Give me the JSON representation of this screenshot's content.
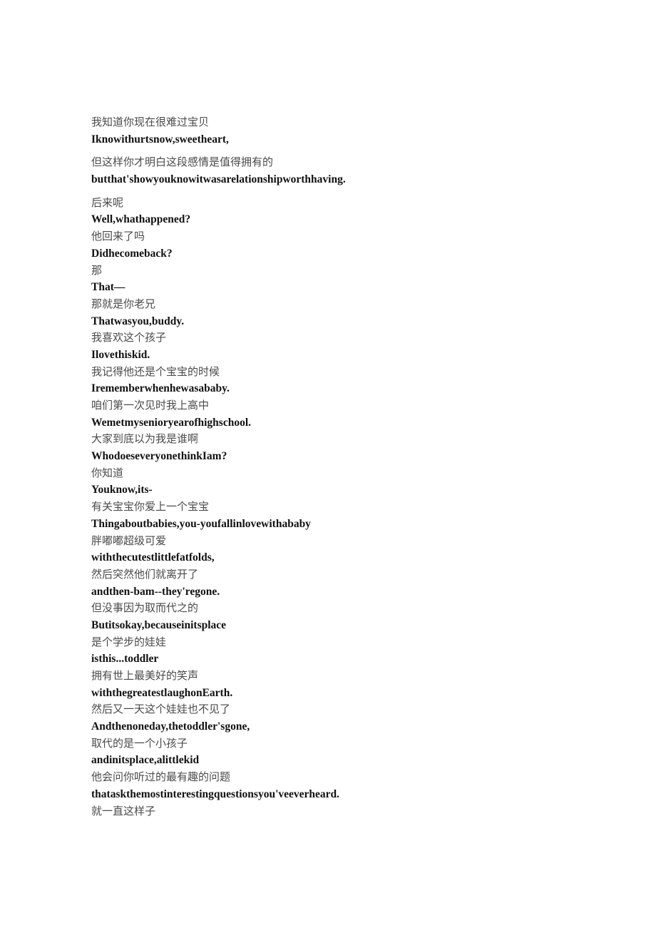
{
  "document": {
    "page_background": "#ffffff",
    "text_color_chinese": "#4a4a4a",
    "text_color_english": "#111111",
    "lines": [
      {
        "lang": "zh",
        "text": "我知道你现在很难过宝贝"
      },
      {
        "lang": "en",
        "text": "Iknowithurtsnow,sweetheart,"
      },
      {
        "lang": "zh",
        "text": "但这样你才明白这段感情是值得拥有的"
      },
      {
        "lang": "en",
        "text": "butthat'showyouknowitwasarelationshipworthhaving."
      },
      {
        "lang": "zh",
        "text": "后来呢"
      },
      {
        "lang": "en",
        "text": "Well,whathappened?"
      },
      {
        "lang": "zh",
        "text": "他回来了吗"
      },
      {
        "lang": "en",
        "text": "Didhecomeback?"
      },
      {
        "lang": "zh",
        "text": "那"
      },
      {
        "lang": "en",
        "text": "That—"
      },
      {
        "lang": "zh",
        "text": "那就是你老兄"
      },
      {
        "lang": "en",
        "text": "Thatwasyou,buddy."
      },
      {
        "lang": "zh",
        "text": "我喜欢这个孩子"
      },
      {
        "lang": "en",
        "text": "Ilovethiskid."
      },
      {
        "lang": "zh",
        "text": "我记得他还是个宝宝的时候"
      },
      {
        "lang": "en",
        "text": "Irememberwhenhewasababy."
      },
      {
        "lang": "zh",
        "text": "咱们第一次见时我上高中"
      },
      {
        "lang": "en",
        "text": "Wemetmysenioryearofhighschool."
      },
      {
        "lang": "zh",
        "text": "大家到底以为我是谁啊"
      },
      {
        "lang": "en",
        "text": "WhodoeseveryonethinkIam?"
      },
      {
        "lang": "zh",
        "text": "你知道"
      },
      {
        "lang": "en",
        "text": "Youknow,its-"
      },
      {
        "lang": "zh",
        "text": "有关宝宝你爱上一个宝宝"
      },
      {
        "lang": "en",
        "text": "Thingaboutbabies,you-youfallinlovewithababy"
      },
      {
        "lang": "zh",
        "text": "胖嘟嘟超级可爱"
      },
      {
        "lang": "en",
        "text": "withthecutestlittlefatfolds,"
      },
      {
        "lang": "zh",
        "text": "然后突然他们就离开了"
      },
      {
        "lang": "en",
        "text": "andthen-bam--they'regone."
      },
      {
        "lang": "zh",
        "text": "但没事因为取而代之的"
      },
      {
        "lang": "en",
        "text": "Butitsokay,becauseinitsplace"
      },
      {
        "lang": "zh",
        "text": "是个学步的娃娃"
      },
      {
        "lang": "en",
        "text": "isthis...toddler"
      },
      {
        "lang": "zh",
        "text": "拥有世上最美好的笑声"
      },
      {
        "lang": "en",
        "text": "withthegreatestlaughonEarth."
      },
      {
        "lang": "zh",
        "text": "然后又一天这个娃娃也不见了"
      },
      {
        "lang": "en",
        "text": "Andthenoneday,thetoddler'sgone,"
      },
      {
        "lang": "zh",
        "text": "取代的是一个小孩子"
      },
      {
        "lang": "en",
        "text": "andinitsplace,alittlekid"
      },
      {
        "lang": "zh",
        "text": "他会问你听过的最有趣的问题"
      },
      {
        "lang": "en",
        "text": "thataskthemostinterestingquestionsyou'veeverheard."
      },
      {
        "lang": "zh",
        "text": "就一直这样子"
      }
    ]
  }
}
